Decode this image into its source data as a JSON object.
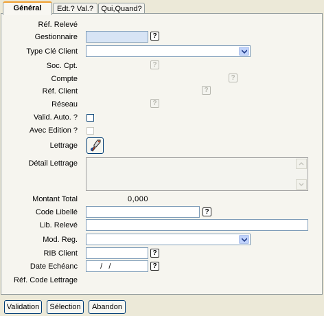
{
  "tabs": [
    {
      "label": "Général",
      "active": true
    },
    {
      "label": "Edt.? Val.?",
      "active": false
    },
    {
      "label": "Qui,Quand?",
      "active": false
    }
  ],
  "form": {
    "ref_releve_label": "Réf. Relevé",
    "gestionnaire_label": "Gestionnaire",
    "gestionnaire_value": "",
    "type_cle_client_label": "Type Clé Client",
    "type_cle_client_value": "",
    "soc_cpt_label": "Soc. Cpt.",
    "compte_label": "Compte",
    "ref_client_label": "Réf. Client",
    "reseau_label": "Réseau",
    "valid_auto_label": "Valid. Auto. ?",
    "valid_auto_checked": false,
    "avec_edition_label": "Avec Edition ?",
    "avec_edition_checked": false,
    "lettrage_label": "Lettrage",
    "detail_lettrage_label": "Détail Lettrage",
    "detail_lettrage_value": "",
    "montant_total_label": "Montant Total",
    "montant_total_value": "0,000",
    "code_libelle_label": "Code Libellé",
    "code_libelle_value": "",
    "lib_releve_label": "Lib. Relevé",
    "lib_releve_value": "",
    "mod_reg_label": "Mod. Reg.",
    "mod_reg_value": "",
    "rib_client_label": "RIB Client",
    "rib_client_value": "",
    "date_echeance_label": "Date Echéanc",
    "date_echeance_value": "  /   /",
    "ref_code_lettrage_label": "Réf. Code Lettrage",
    "help_glyph": "?"
  },
  "buttons": {
    "validation": "Validation",
    "selection": "Sélection",
    "abandon": "Abandon"
  },
  "colors": {
    "window_bg": "#ece9d8",
    "panel_bg": "#f6f5ef",
    "tab_accent": "#f0a030",
    "focused_field": "#d7e4f5",
    "border_blue": "#7f9db9"
  }
}
